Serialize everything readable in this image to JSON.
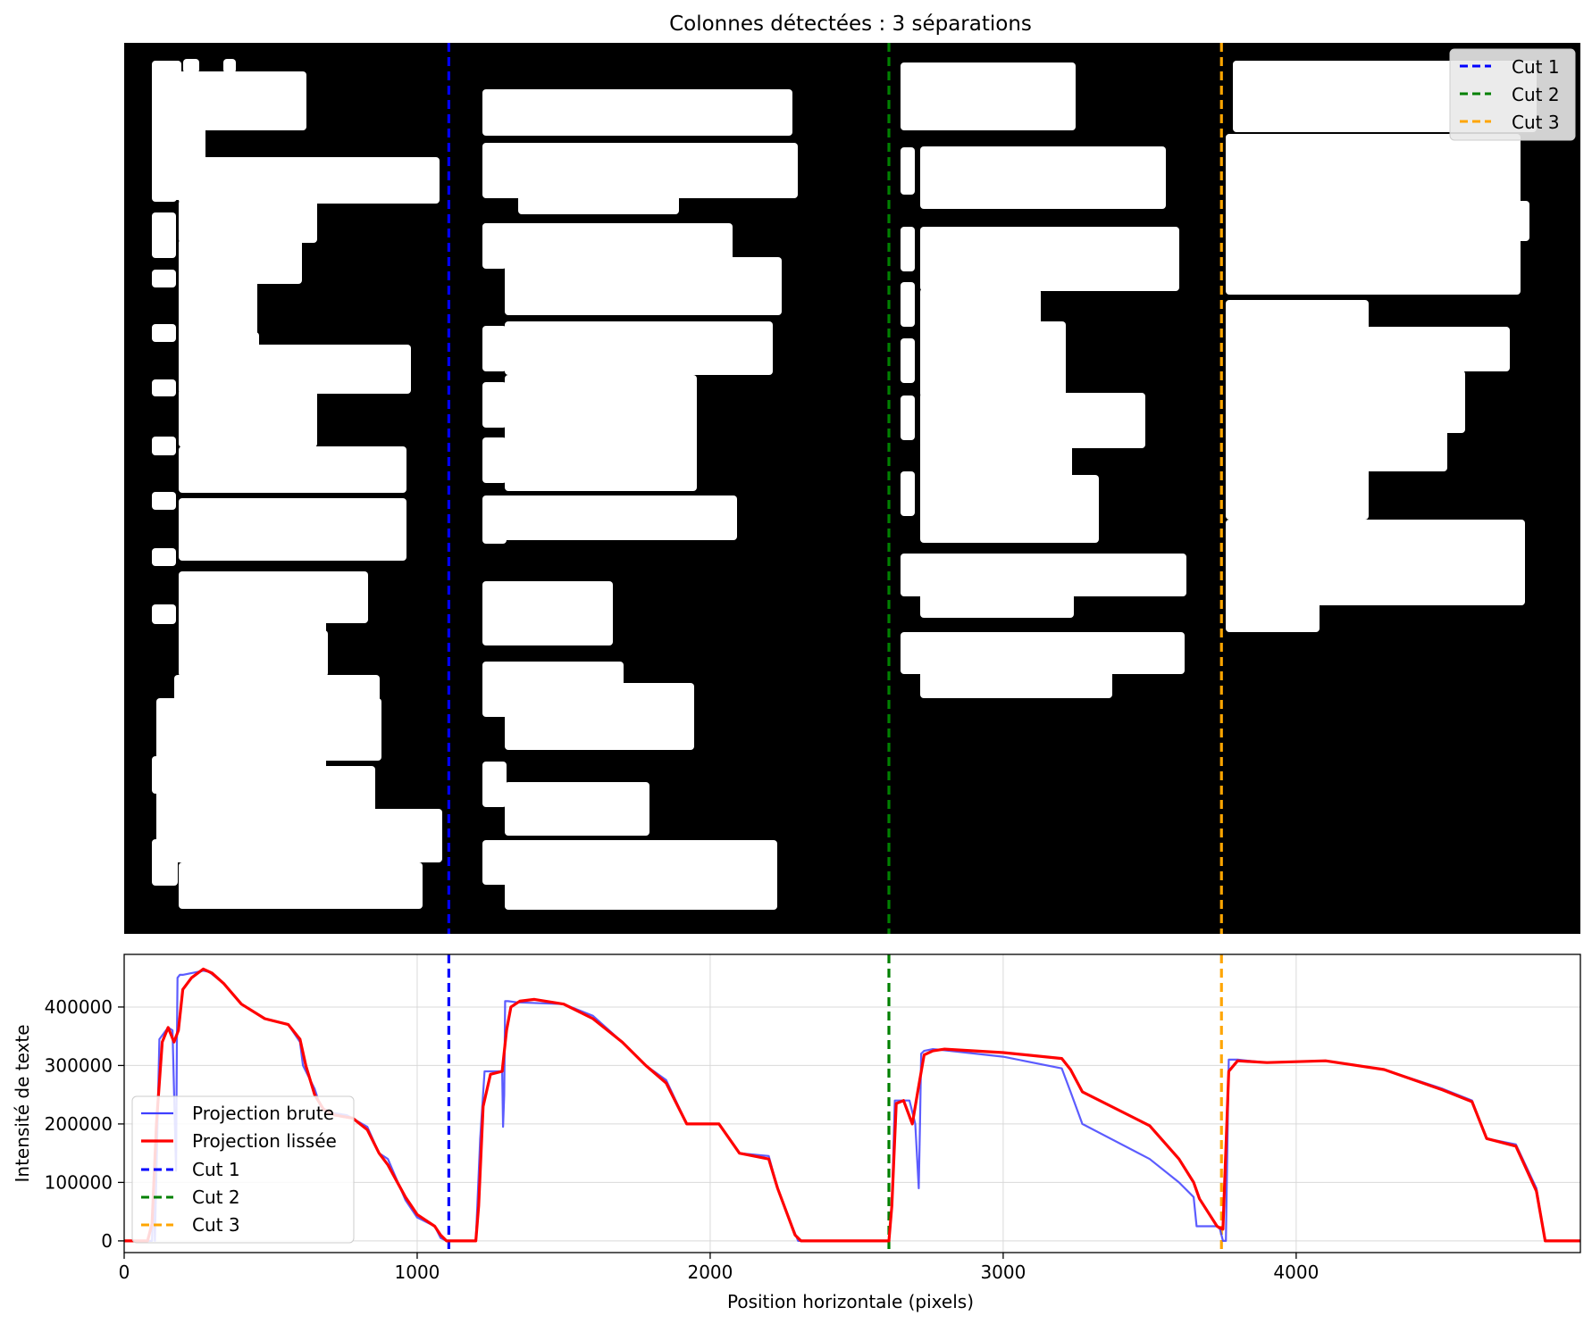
{
  "chart_data": [
    {
      "type": "image",
      "title": "Colonnes détectées : 3 séparations",
      "x_range": [
        0,
        4970
      ],
      "cuts": [
        {
          "name": "Cut 1",
          "x": 1108,
          "color": "#0000ff"
        },
        {
          "name": "Cut 2",
          "x": 2610,
          "color": "#008000"
        },
        {
          "name": "Cut 3",
          "x": 3745,
          "color": "#ffa500"
        }
      ],
      "legend": {
        "placement": "top-right",
        "entries": [
          "Cut 1",
          "Cut 2",
          "Cut 3"
        ]
      }
    },
    {
      "type": "line",
      "xlabel": "Position horizontale (pixels)",
      "ylabel": "Intensité de texte",
      "xlim": [
        0,
        4970
      ],
      "ylim": [
        -20000,
        490000
      ],
      "xticks": [
        0,
        1000,
        2000,
        3000,
        4000
      ],
      "yticks": [
        0,
        100000,
        200000,
        300000,
        400000
      ],
      "grid": true,
      "legend": {
        "placement": "lower-left",
        "entries": [
          "Projection brute",
          "Projection lissée",
          "Cut 1",
          "Cut 2",
          "Cut 3"
        ]
      },
      "series": [
        {
          "name": "Projection brute",
          "color": "#3f3fff",
          "x": [
            0,
            95,
            100,
            105,
            120,
            150,
            165,
            175,
            177,
            180,
            182,
            190,
            200,
            270,
            290,
            340,
            400,
            480,
            560,
            600,
            610,
            650,
            670,
            700,
            760,
            830,
            870,
            900,
            960,
            1000,
            1060,
            1080,
            1100,
            1200,
            1215,
            1230,
            1290,
            1293,
            1297,
            1300,
            1310,
            1340,
            1500,
            1600,
            1700,
            1780,
            1850,
            1920,
            2030,
            2100,
            2200,
            2230,
            2260,
            2300,
            2600,
            2610,
            2620,
            2630,
            2680,
            2700,
            2712,
            2716,
            2720,
            2730,
            2760,
            2800,
            3000,
            3200,
            3230,
            3270,
            3500,
            3600,
            3650,
            3660,
            3730,
            3740,
            3750,
            3755,
            3760,
            3770,
            3800,
            3900,
            4100,
            4300,
            4500,
            4600,
            4650,
            4750,
            4820,
            4850,
            4970
          ],
          "y": [
            0,
            0,
            100000,
            0,
            345000,
            365000,
            360000,
            160000,
            120000,
            340000,
            450000,
            455000,
            455000,
            462000,
            460000,
            440000,
            405000,
            380000,
            370000,
            340000,
            300000,
            260000,
            230000,
            220000,
            215000,
            195000,
            150000,
            140000,
            70000,
            40000,
            25000,
            5000,
            0,
            0,
            175000,
            290000,
            290000,
            195000,
            250000,
            410000,
            410000,
            408000,
            405000,
            385000,
            340000,
            300000,
            275000,
            200000,
            200000,
            150000,
            145000,
            90000,
            50000,
            0,
            0,
            0,
            60000,
            240000,
            240000,
            200000,
            90000,
            200000,
            320000,
            325000,
            328000,
            326000,
            315000,
            295000,
            255000,
            200000,
            140000,
            100000,
            75000,
            25000,
            25000,
            20000,
            0,
            0,
            0,
            310000,
            310000,
            305000,
            308000,
            293000,
            260000,
            240000,
            175000,
            165000,
            90000,
            0,
            0
          ]
        },
        {
          "name": "Projection lissée",
          "color": "#ff0000",
          "x": [
            0,
            80,
            95,
            110,
            130,
            150,
            170,
            185,
            200,
            230,
            270,
            300,
            340,
            400,
            480,
            560,
            600,
            620,
            650,
            680,
            720,
            780,
            830,
            870,
            900,
            960,
            1000,
            1060,
            1080,
            1100,
            1130,
            1200,
            1210,
            1225,
            1250,
            1290,
            1305,
            1320,
            1350,
            1400,
            1500,
            1600,
            1700,
            1780,
            1850,
            1920,
            2030,
            2100,
            2200,
            2230,
            2260,
            2290,
            2310,
            2600,
            2610,
            2620,
            2635,
            2660,
            2690,
            2710,
            2730,
            2760,
            2800,
            3000,
            3200,
            3230,
            3270,
            3500,
            3600,
            3650,
            3670,
            3730,
            3740,
            3750,
            3770,
            3800,
            3900,
            4100,
            4300,
            4500,
            4600,
            4650,
            4750,
            4820,
            4850,
            4970
          ],
          "y": [
            0,
            0,
            30000,
            200000,
            340000,
            365000,
            340000,
            360000,
            430000,
            450000,
            465000,
            458000,
            440000,
            405000,
            380000,
            370000,
            345000,
            300000,
            250000,
            225000,
            215000,
            210000,
            190000,
            150000,
            130000,
            75000,
            45000,
            25000,
            10000,
            0,
            0,
            0,
            60000,
            230000,
            285000,
            290000,
            360000,
            400000,
            410000,
            413000,
            405000,
            380000,
            340000,
            300000,
            270000,
            200000,
            200000,
            150000,
            140000,
            90000,
            50000,
            10000,
            0,
            0,
            0,
            60000,
            235000,
            240000,
            200000,
            260000,
            318000,
            325000,
            328000,
            322000,
            312000,
            293000,
            255000,
            197000,
            140000,
            100000,
            72000,
            25000,
            22000,
            20000,
            290000,
            308000,
            305000,
            308000,
            293000,
            258000,
            238000,
            175000,
            162000,
            85000,
            0,
            0
          ]
        }
      ]
    }
  ]
}
